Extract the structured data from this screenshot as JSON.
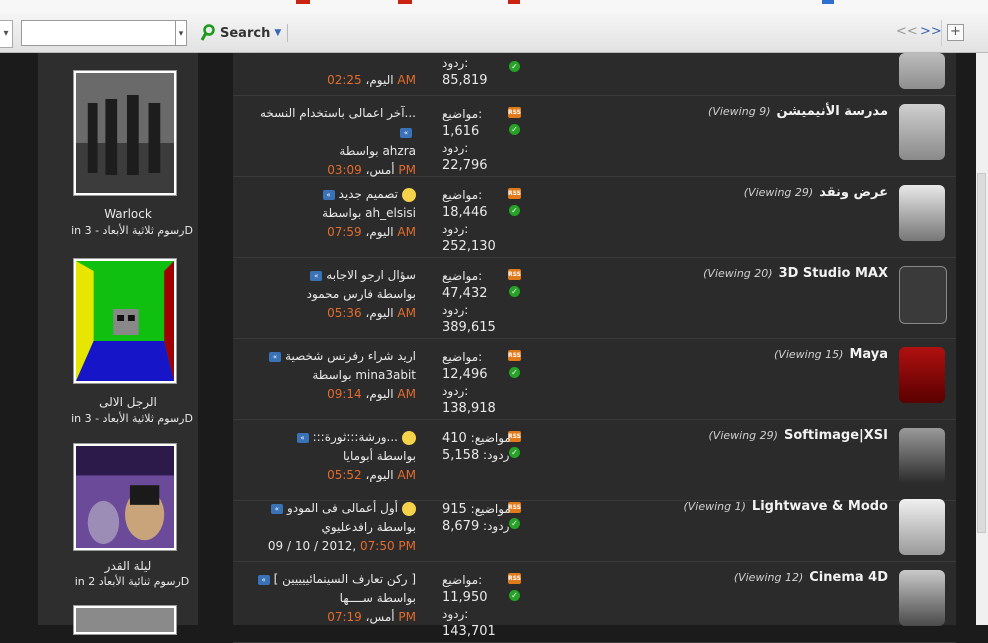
{
  "toolbar": {
    "search_value": "",
    "search_label": "Search",
    "nav_prev": "<<",
    "nav_next": ">>",
    "add_label": "+"
  },
  "sidebar": {
    "items": [
      {
        "title": "Warlock",
        "category": "in رسوم ثلاثية الأبعاد - 3D"
      },
      {
        "title": "الرجل الالى",
        "category": "in رسوم ثلاثية الأبعاد - 3D"
      },
      {
        "title": "ليلة القدر",
        "category": "in رسوم ثنائية الأبعاد 2D"
      }
    ]
  },
  "forums": [
    {
      "name": "",
      "viewing": "",
      "stat1": "",
      "stat1_val": "",
      "stat2": "ردود:",
      "stat2_val": "85,819",
      "last_title": "",
      "last_by": "",
      "last_date": "اليوم،",
      "last_time": "02:25 AM"
    },
    {
      "name": "مدرسة الأنيميشن",
      "viewing": "(Viewing 9)",
      "stat1": "مواضيع:",
      "stat1_val": "1,616",
      "stat2": "ردود:",
      "stat2_val": "22,796",
      "last_title": "آخر اعمالى باستخدام النسخه...",
      "last_by": "بواسطة ahzra",
      "last_date": "أمس،",
      "last_time": "03:09 PM"
    },
    {
      "name": "عرض ونقد",
      "viewing": "(Viewing 29)",
      "stat1": "مواضيع:",
      "stat1_val": "18,446",
      "stat2": "ردود:",
      "stat2_val": "252,130",
      "last_title": "تصميم جديد",
      "last_by": "بواسطة ah_elsisi",
      "last_date": "اليوم،",
      "last_time": "07:59 AM"
    },
    {
      "name": "3D Studio MAX",
      "viewing": "(Viewing 20)",
      "stat1": "مواضيع:",
      "stat1_val": "47,432",
      "stat2": "ردود:",
      "stat2_val": "389,615",
      "last_title": "سؤال ارجو الاجابه",
      "last_by": "بواسطة فارس محمود",
      "last_date": "اليوم،",
      "last_time": "05:36 AM"
    },
    {
      "name": "Maya",
      "viewing": "(Viewing 15)",
      "stat1": "مواضيع:",
      "stat1_val": "12,496",
      "stat2": "ردود:",
      "stat2_val": "138,918",
      "last_title": "اريد شراء رفرنس شخصية",
      "last_by": "بواسطة mina3abit",
      "last_date": "اليوم،",
      "last_time": "09:14 AM"
    },
    {
      "name": "Softimage|XSI",
      "viewing": "(Viewing 29)",
      "stat1": "مواضيع:",
      "stat1_val": "410",
      "stat2": "ردود:",
      "stat2_val": "5,158",
      "last_title": ":::ورشة:::ثورة...",
      "last_by": "بواسطة أبومايا",
      "last_date": "اليوم،",
      "last_time": "05:52 AM"
    },
    {
      "name": "Lightwave & Modo",
      "viewing": "(Viewing 1)",
      "stat1": "مواضيع:",
      "stat1_val": "915",
      "stat2": "ردود:",
      "stat2_val": "8,679",
      "last_title": "أول أعمالى فى المودو",
      "last_by": "بواسطة رافدعليوي",
      "last_date": "09 / 10 / 2012,",
      "last_time": "07:50 PM"
    },
    {
      "name": "Cinema 4D",
      "viewing": "(Viewing 12)",
      "stat1": "مواضيع:",
      "stat1_val": "11,950",
      "stat2": "ردود:",
      "stat2_val": "143,701",
      "last_title": "[ ركن تعارف السينمائييييين ]",
      "last_by": "بواسطة ســــها",
      "last_date": "أمس،",
      "last_time": "07:19 PM"
    }
  ],
  "colors": {
    "accent_time": "#e36c2c",
    "rss": "#e07a1a",
    "online": "#26a326"
  }
}
